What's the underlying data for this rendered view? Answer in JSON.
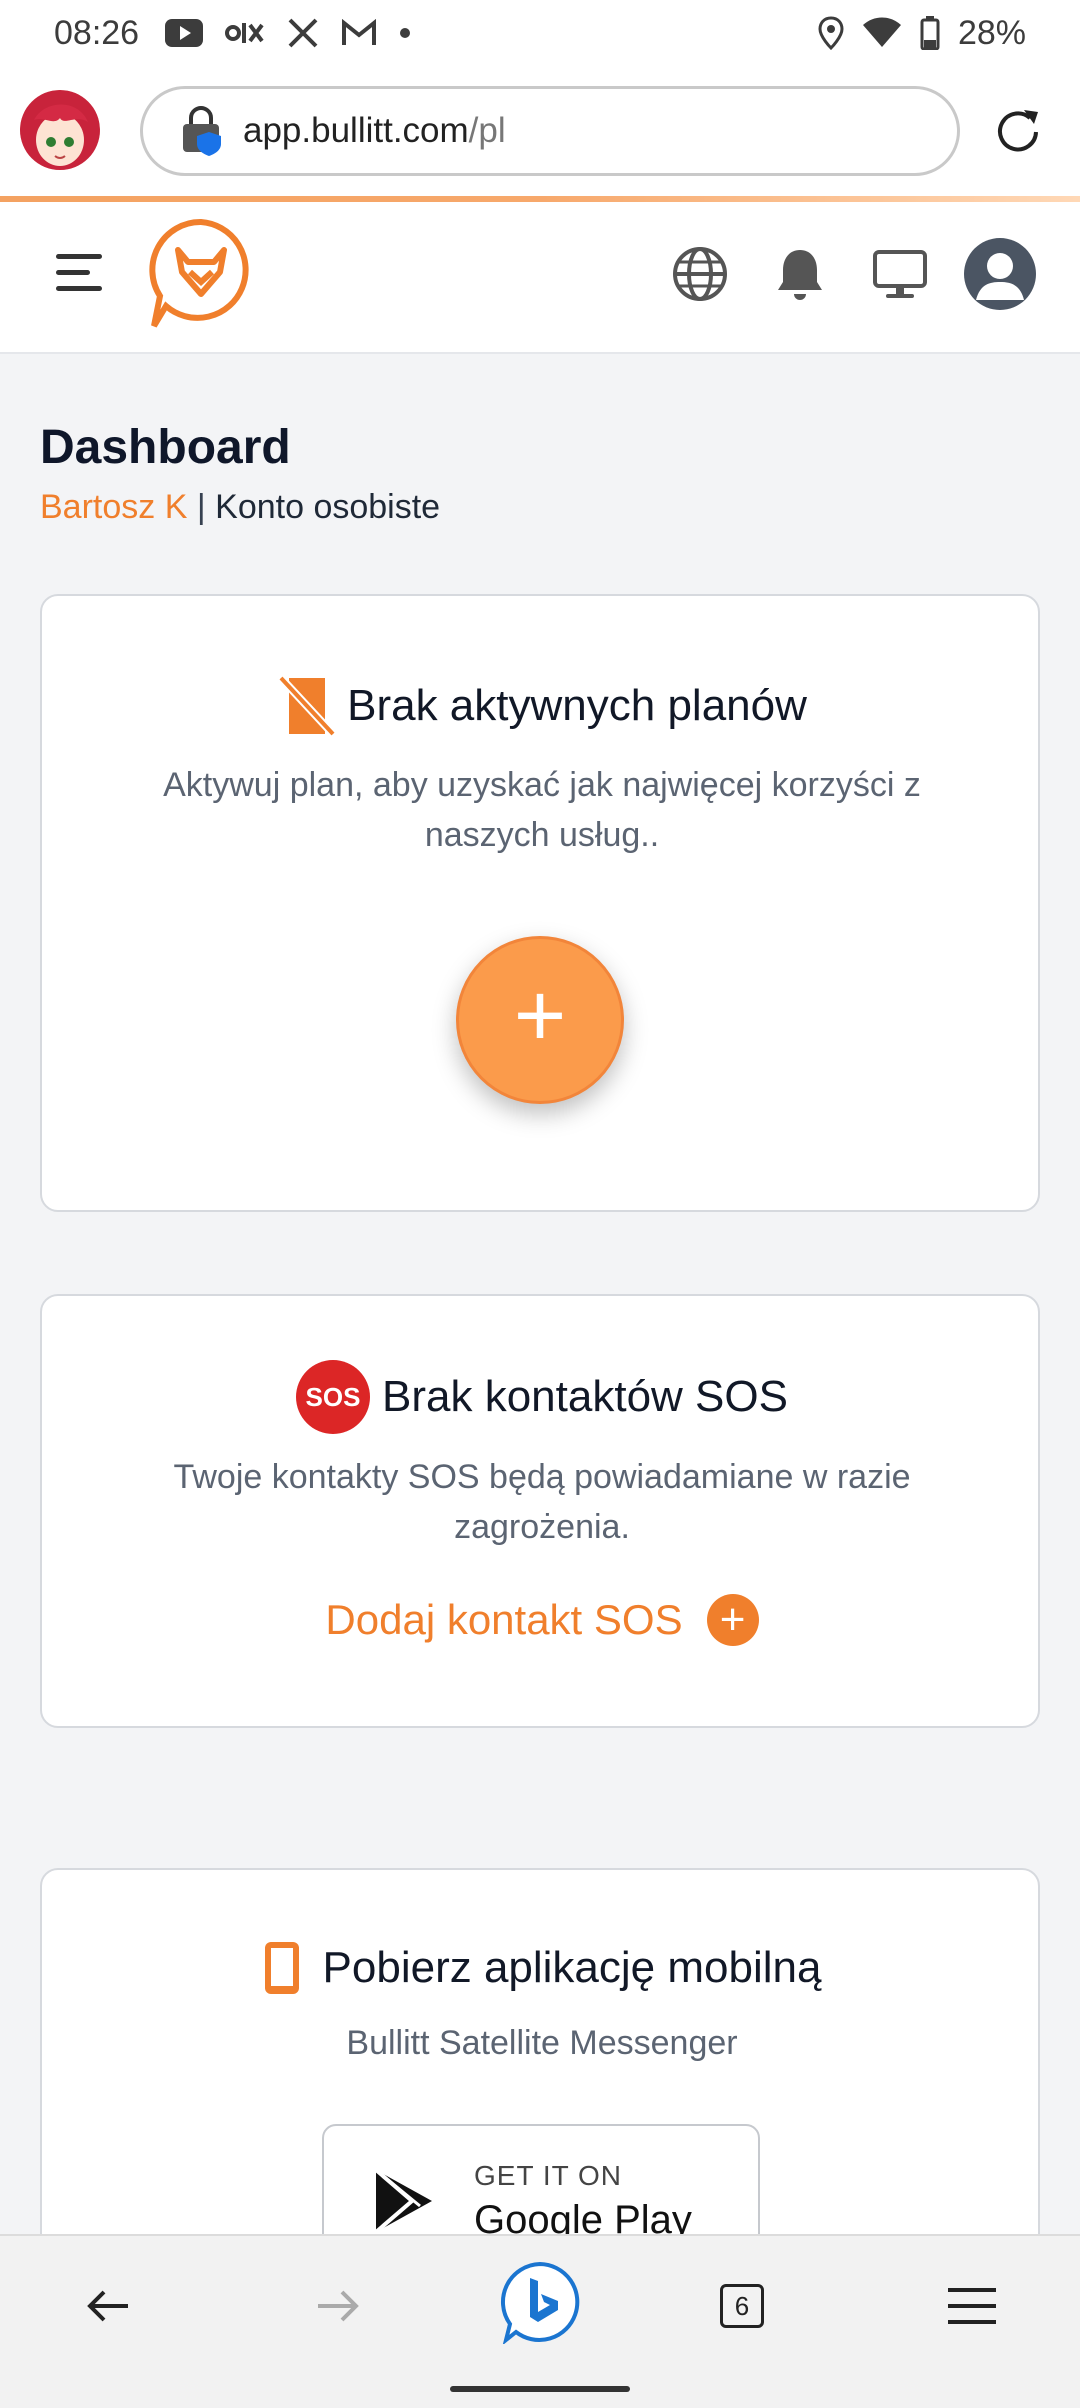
{
  "status_bar": {
    "time": "08:26",
    "battery": "28%",
    "icons_left": [
      "youtube-icon",
      "olx-icon",
      "x-icon",
      "gmail-icon",
      "dot-icon"
    ],
    "icons_right": [
      "location-icon",
      "wifi-icon",
      "battery-icon"
    ]
  },
  "browser": {
    "url_host": "app.bullitt.com",
    "url_path": "/pl",
    "tabs_count": "6"
  },
  "header": {
    "icons": [
      "menu-icon",
      "bullitt-logo",
      "globe-icon",
      "bell-icon",
      "monitor-icon",
      "profile-icon"
    ]
  },
  "page": {
    "title": "Dashboard",
    "user_name": "Bartosz K",
    "separator": "|",
    "account_type": "Konto osobiste"
  },
  "plans_card": {
    "title": "Brak aktywnych planów",
    "description": "Aktywuj plan, aby uzyskać jak najwięcej korzyści z naszych usług..",
    "add_button": "+"
  },
  "sos_card": {
    "badge": "SOS",
    "title": "Brak kontaktów SOS",
    "description": "Twoje kontakty SOS będą powiadamiane w razie zagrożenia.",
    "add_link": "Dodaj kontakt SOS",
    "add_icon": "+"
  },
  "app_card": {
    "title": "Pobierz aplikację mobilną",
    "subtitle": "Bullitt Satellite Messenger",
    "store_small": "GET IT ON",
    "store_big": "Google Play"
  },
  "colors": {
    "accent": "#f07f2c",
    "plus_button": "#fb9b4b",
    "sos_red": "#dc2626"
  }
}
